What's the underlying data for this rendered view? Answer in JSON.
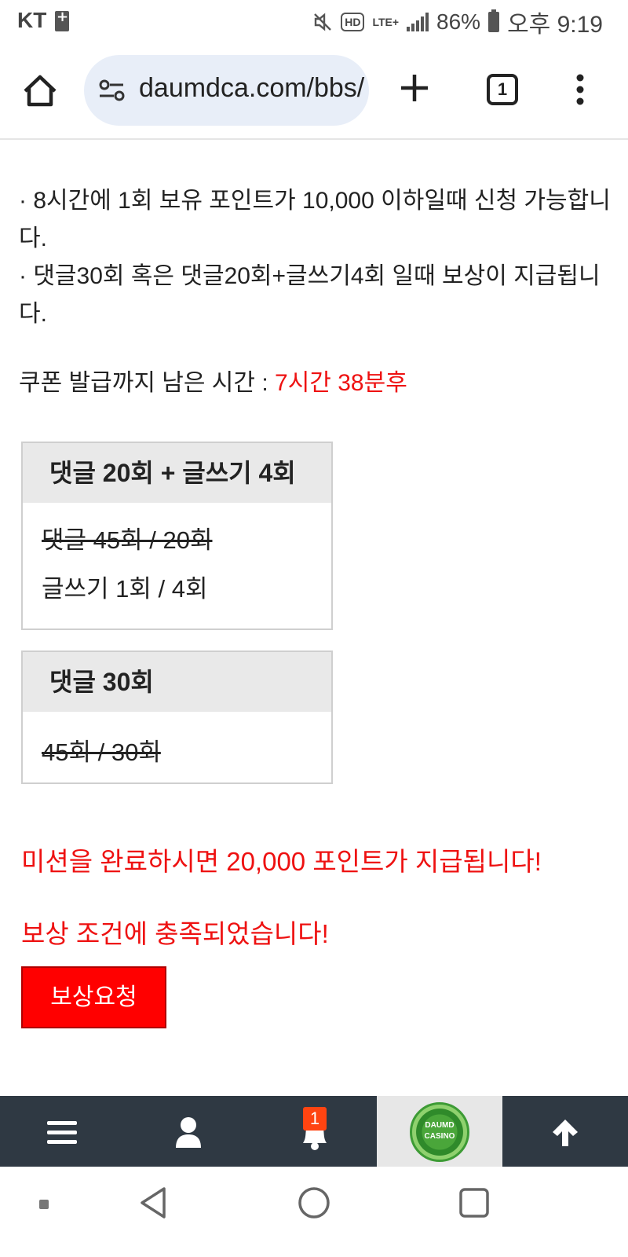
{
  "status_bar": {
    "carrier": "KT",
    "battery": "86%",
    "time": "오후 9:19",
    "lte": "LTE+"
  },
  "browser": {
    "url": "daumdca.com/bbs/",
    "tab_count": "1"
  },
  "content": {
    "info_line_1": "· 8시간에 1회 보유 포인트가 10,000 이하일때 신청 가능합니다.",
    "info_line_2": "· 댓글30회 혹은 댓글20회+글쓰기4회 일때 보상이 지급됩니다.",
    "timer_label": "쿠폰 발급까지 남은 시간 : ",
    "timer_value": "7시간 38분후",
    "mission_a": {
      "title": "댓글 20회 + 글쓰기 4회",
      "row1": "댓글 45회 / 20회",
      "row2": "글쓰기 1회 / 4회"
    },
    "mission_b": {
      "title": "댓글 30회",
      "row1": "45회 / 30회"
    },
    "reward_message": "미션을 완료하시면 20,000 포인트가 지급됩니다!",
    "condition_message": "보상 조건에 충족되었습니다!",
    "reward_button": "보상요청"
  },
  "bottom_nav": {
    "notification_count": "1",
    "logo_text_1": "DAUMD",
    "logo_text_2": "CASINO"
  },
  "colors": {
    "accent_red": "#ee1111",
    "button_red": "#ff0000",
    "nav_dark": "#2f3943"
  },
  "icons": [
    "home-icon",
    "site-settings-icon",
    "plus-icon",
    "tabs-icon",
    "more-icon",
    "hamburger-icon",
    "user-icon",
    "bell-icon",
    "arrow-up-icon",
    "back-icon",
    "home-circle-icon",
    "recents-icon"
  ]
}
